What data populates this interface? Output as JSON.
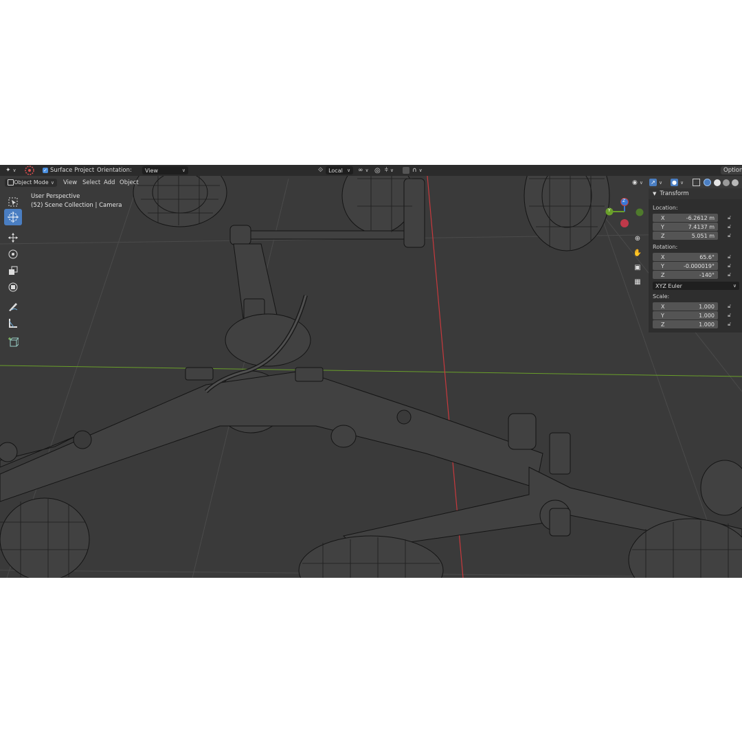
{
  "topbar": {
    "surface_project": "Surface Project",
    "orientation_label": "Orientation:",
    "orientation_value": "View",
    "transform_pivot": "Local",
    "options": "Options"
  },
  "viewport_header": {
    "mode": "Object Mode",
    "menus": [
      "View",
      "Select",
      "Add",
      "Object"
    ]
  },
  "overlay": {
    "perspective": "User Perspective",
    "collection": "(52) Scene Collection | Camera"
  },
  "gizmo": {
    "x": "X",
    "y": "Y",
    "z": "Z"
  },
  "panel": {
    "title": "Transform",
    "location_label": "Location:",
    "location": [
      {
        "axis": "X",
        "value": "-6.2612 m"
      },
      {
        "axis": "Y",
        "value": "7.4137 m"
      },
      {
        "axis": "Z",
        "value": "5.051 m"
      }
    ],
    "rotation_label": "Rotation:",
    "rotation": [
      {
        "axis": "X",
        "value": "65.6°"
      },
      {
        "axis": "Y",
        "value": "-0.000019°"
      },
      {
        "axis": "Z",
        "value": "-140°"
      }
    ],
    "rotation_mode": "XYZ Euler",
    "scale_label": "Scale:",
    "scale": [
      {
        "axis": "X",
        "value": "1.000"
      },
      {
        "axis": "Y",
        "value": "1.000"
      },
      {
        "axis": "Z",
        "value": "1.000"
      }
    ]
  },
  "colors": {
    "viewport_bg": "#3a3a3a",
    "x_axis_line": "#c8393d",
    "y_axis_line": "#6aa02a",
    "active_tool": "#4a7ec2",
    "gizmo_x": "#c8393d",
    "gizmo_y": "#6aa02a",
    "gizmo_z": "#3a78d6"
  },
  "icons": [
    "editor-type-icon",
    "snap-target-icon",
    "orientation-icon",
    "pivot-local-icon",
    "link-icon",
    "proportional-edit-icon",
    "falloff-icon",
    "visibility-icon",
    "gizmo-icon",
    "overlay-icon",
    "xray-icon",
    "shading-wire-icon",
    "shading-solid-icon",
    "shading-material-icon",
    "shading-rendered-icon",
    "zoom-icon",
    "hand-icon",
    "camera-icon",
    "grid-icon",
    "select-box-icon",
    "cursor-icon",
    "move-icon",
    "rotate-icon",
    "scale-icon",
    "transform-icon",
    "annotate-icon",
    "measure-icon",
    "add-cube-icon",
    "lock-icon"
  ]
}
